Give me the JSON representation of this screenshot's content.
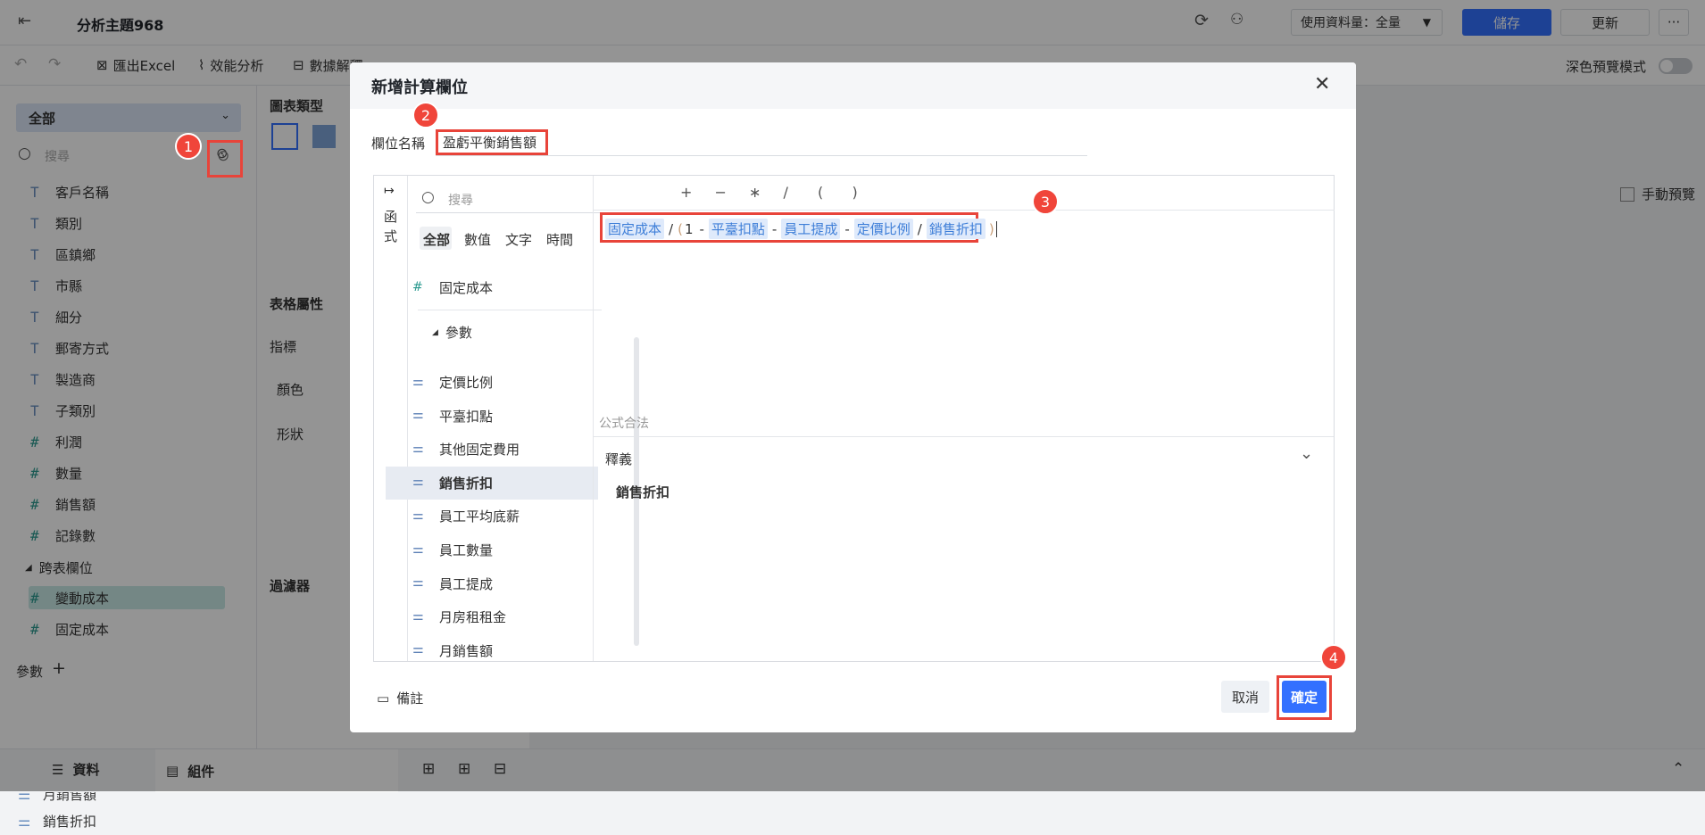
{
  "topbar": {
    "title": "分析主題968",
    "data_volume_label": "使用資料量：全量",
    "save_label": "儲存",
    "update_label": "更新",
    "more_label": "···"
  },
  "toolbar": {
    "export_label": "匯出Excel",
    "perf_label": "效能分析",
    "explain_label": "數據解釋",
    "dark_preview_label": "深色預覽模式"
  },
  "left": {
    "dropdown": "全部",
    "search_placeholder": "搜尋",
    "fields": [
      {
        "icon": "T",
        "label": "客戶名稱"
      },
      {
        "icon": "T",
        "label": "類別"
      },
      {
        "icon": "T",
        "label": "區鎮鄉"
      },
      {
        "icon": "T",
        "label": "市縣"
      },
      {
        "icon": "T",
        "label": "細分"
      },
      {
        "icon": "T",
        "label": "郵寄方式"
      },
      {
        "icon": "T",
        "label": "製造商"
      },
      {
        "icon": "T",
        "label": "子類別"
      },
      {
        "icon": "#",
        "label": "利潤"
      },
      {
        "icon": "#",
        "label": "數量"
      },
      {
        "icon": "#",
        "label": "銷售額"
      },
      {
        "icon": "#",
        "label": "記錄數"
      }
    ],
    "cross_table": "跨表欄位",
    "cross_fields": [
      "變動成本",
      "固定成本"
    ],
    "params_label": "參數",
    "params": [
      "月銷售額",
      "銷售折扣"
    ]
  },
  "mid": {
    "chart_type": "圖表類型",
    "table_attr": "表格屬性",
    "metric": "指標",
    "color": "顏色",
    "shape": "形狀",
    "filter": "過濾器"
  },
  "right": {
    "manual_preview": "手動預覽"
  },
  "bottombar": {
    "data_tab": "資料",
    "component_tab": "組件"
  },
  "dialog": {
    "title": "新增計算欄位",
    "name_label": "欄位名稱",
    "name_value": "盈虧平衡銷售額",
    "side_tab": "函式",
    "search_placeholder": "搜尋",
    "categories": [
      "全部",
      "數值",
      "文字",
      "時間"
    ],
    "top_item": "固定成本",
    "param_group": "參數",
    "param_items": [
      "定價比例",
      "平臺扣點",
      "其他固定費用",
      "銷售折扣",
      "員工平均底薪",
      "員工數量",
      "員工提成",
      "月房租租金",
      "月銷售額"
    ],
    "selected_item": "銷售折扣",
    "operators": [
      "+",
      "−",
      "∗",
      "/",
      "(",
      ")"
    ],
    "formula": {
      "f1": "固定成本",
      "o1": "/",
      "p1": "(",
      "n1": "1",
      "o2": "-",
      "f2": "平臺扣點",
      "o3": "-",
      "f3": "員工提成",
      "o4": "-",
      "f4": "定價比例",
      "o5": "/",
      "f5": "銷售折扣",
      "p2": ")"
    },
    "valid_text": "公式合法",
    "explain_title": "釋義",
    "explain_body": "銷售折扣",
    "note_label": "備註",
    "cancel_label": "取消",
    "confirm_label": "確定"
  },
  "badges": [
    "1",
    "2",
    "3",
    "4"
  ]
}
